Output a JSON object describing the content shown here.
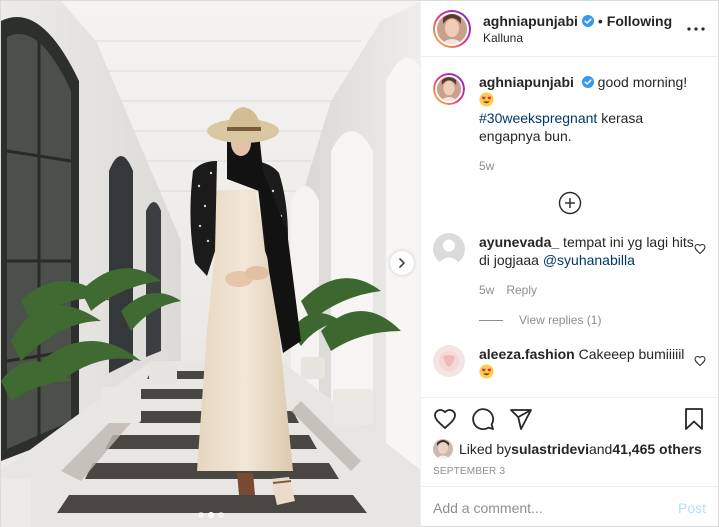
{
  "post": {
    "author": {
      "username": "aghniapunjabi",
      "verified": true,
      "following_label": "Following",
      "separator": "•",
      "location": "Kalluna"
    },
    "caption": {
      "username": "aghniapunjabi",
      "text": "good morning!",
      "hashtag": "#30weekspregnant",
      "text2": " kerasa engapnya bun.",
      "time": "5w"
    },
    "comments": [
      {
        "username": "ayunevada_",
        "text": " tempat ini yg lagi hits di jogjaaa ",
        "mention": "@syuhanabilla",
        "time": "5w",
        "reply_label": "Reply",
        "view_replies": "View replies (1)"
      },
      {
        "username": "aleeza.fashion",
        "text": " Cakeeep bumiiiiil"
      }
    ],
    "likes": {
      "prefix": "Liked by ",
      "user": "sulastridevi",
      "middle": " and ",
      "count": "41,465 others"
    },
    "date": "SEPTEMBER 3",
    "add_comment": {
      "placeholder": "Add a comment...",
      "post_label": "Post"
    },
    "carousel": {
      "total": 3,
      "active": 2
    },
    "colors": {
      "link": "#00376b",
      "muted": "#8e8e8e",
      "post_disabled": "#b2dffc",
      "verified_blue": "#3897f0"
    },
    "icons": [
      "more-icon",
      "load-more-icon",
      "heart-icon",
      "comment-icon",
      "share-icon",
      "save-icon",
      "verified-icon",
      "next-arrow-icon",
      "heart-eyes-emoji"
    ]
  }
}
